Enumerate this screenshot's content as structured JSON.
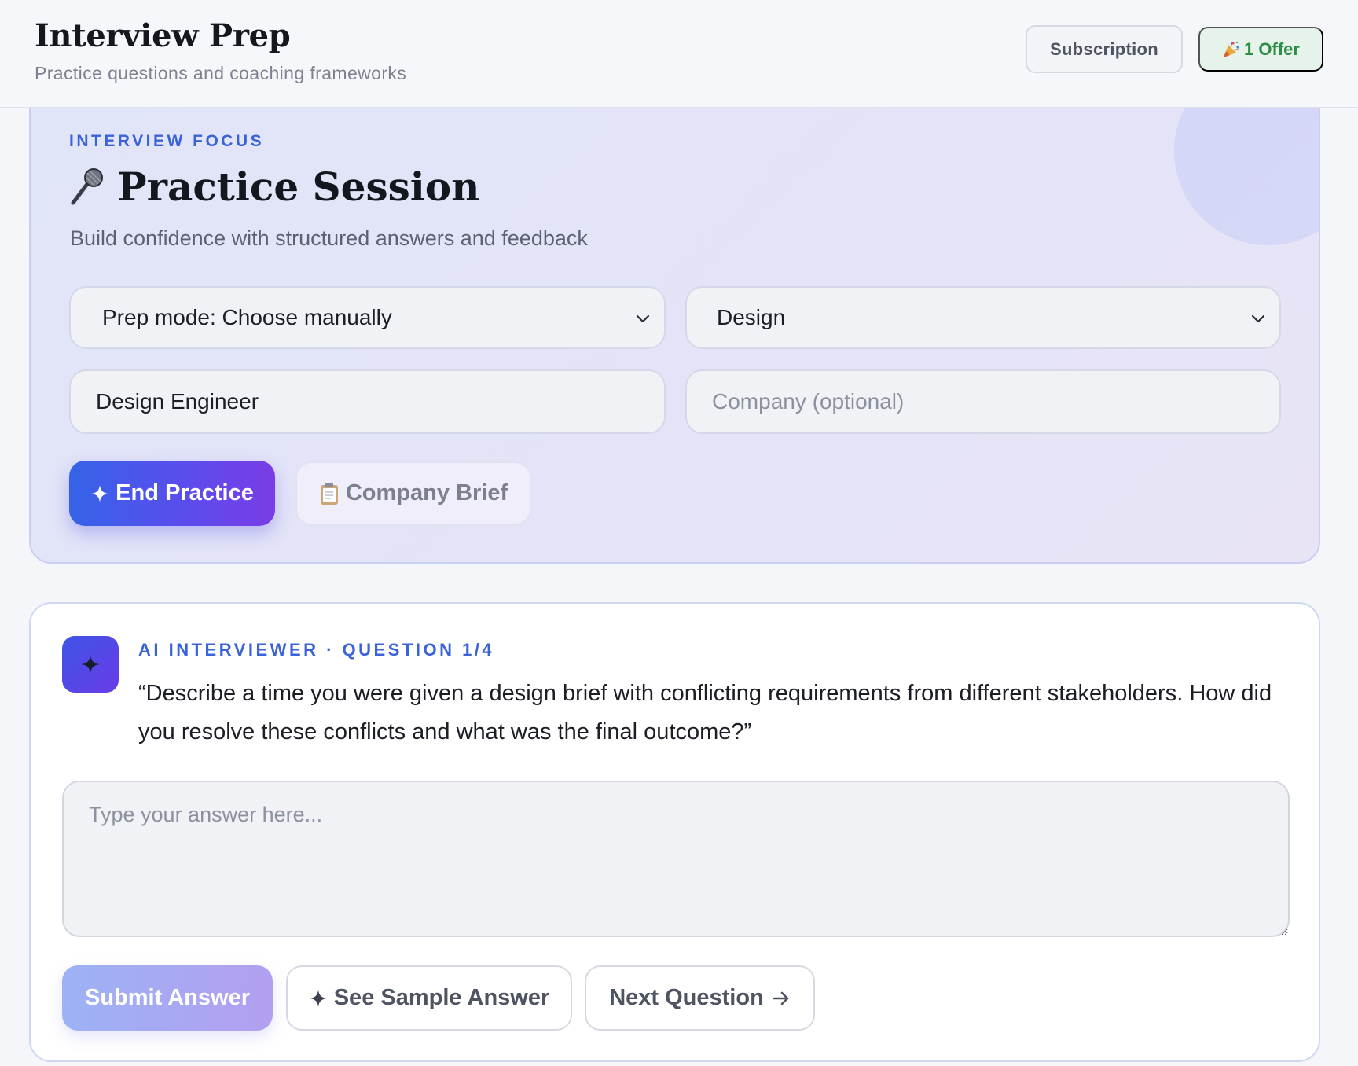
{
  "header": {
    "title": "Interview Prep",
    "subtitle": "Practice questions and coaching frameworks",
    "subscription_label": "Subscription",
    "offer_label": "1 Offer",
    "offer_icon": "party-popper-icon"
  },
  "focus": {
    "eyebrow": "INTERVIEW FOCUS",
    "title": "Practice Session",
    "title_icon": "microphone-icon",
    "subtitle": "Build confidence with structured answers and feedback",
    "prep_mode_value": "Prep mode: Choose manually",
    "department_value": "Design",
    "role_value": "Design Engineer",
    "company_placeholder": "Company (optional)",
    "end_practice_label": "End Practice",
    "company_brief_label": "Company Brief",
    "company_brief_icon": "clipboard-icon"
  },
  "interviewer": {
    "eyebrow": "AI INTERVIEWER · QUESTION 1/4",
    "question": "“Describe a time you were given a design brief with conflicting requirements from different stakeholders. How did you resolve these conflicts and what was the final outcome?”",
    "answer_placeholder": "Type your answer here...",
    "submit_label": "Submit Answer",
    "sample_label": "See Sample Answer",
    "next_label": "Next Question"
  },
  "colors": {
    "accent_blue": "#3a62d9",
    "gradient_start": "#3563e8",
    "gradient_end": "#7a3ce6",
    "offer_green": "#2f8c47"
  }
}
